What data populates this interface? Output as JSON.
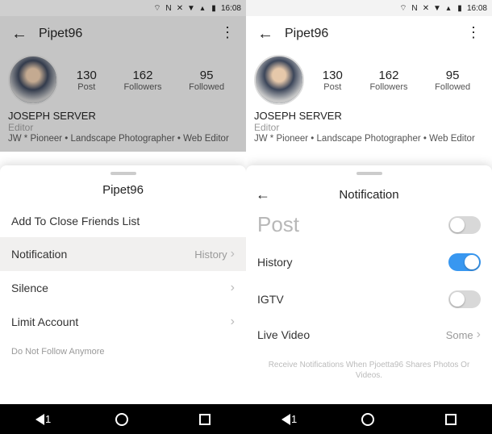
{
  "statusbar": {
    "time": "16:08"
  },
  "profile": {
    "username": "Pipet96",
    "display_name": "JOSEPH SERVER",
    "role": "Editor",
    "bio": "JW * Pioneer • Landscape Photographer • Web Editor",
    "stats": {
      "posts": {
        "value": "130",
        "label": "Post"
      },
      "followers": {
        "value": "162",
        "label": "Followers"
      },
      "following": {
        "value": "95",
        "label": "Followed"
      }
    }
  },
  "sheet_left": {
    "title": "Pipet96",
    "items": {
      "close_friends": "Add To Close Friends List",
      "notification": "Notification",
      "notification_value": "History",
      "silence": "Silence",
      "limit": "Limit Account",
      "unfollow": "Do Not Follow Anymore"
    }
  },
  "sheet_right": {
    "title": "Notification",
    "items": {
      "post": "Post",
      "history": "History",
      "igtv": "IGTV",
      "live": "Live Video",
      "live_value": "Some"
    },
    "footer": "Receive Notifications When Pjoetta96 Shares Photos Or Videos."
  },
  "nav": {
    "back_badge": "1"
  }
}
